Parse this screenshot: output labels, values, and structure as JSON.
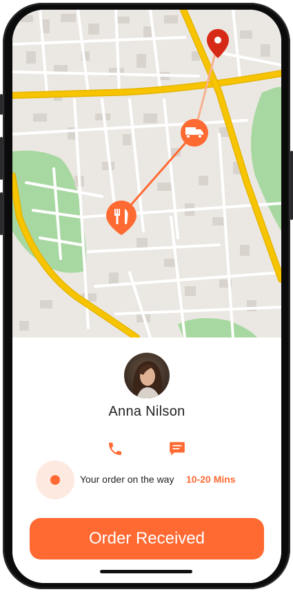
{
  "colors": {
    "accent": "#ff6a33",
    "map_background": "#ebe8e3",
    "road_major": "#f7c400",
    "park": "#a8d8a1",
    "pin_red": "#d62916"
  },
  "map": {
    "destination_pin_icon": "location-pin-icon",
    "delivery_vehicle_icon": "truck-icon",
    "restaurant_marker_icon": "fork-knife-icon"
  },
  "driver": {
    "name": "Anna Nilson",
    "call_icon": "phone-icon",
    "message_icon": "chat-bubble-icon"
  },
  "status": {
    "text": "Your order on the way",
    "eta": "10-20 Mins"
  },
  "actions": {
    "order_received_label": "Order Received"
  }
}
